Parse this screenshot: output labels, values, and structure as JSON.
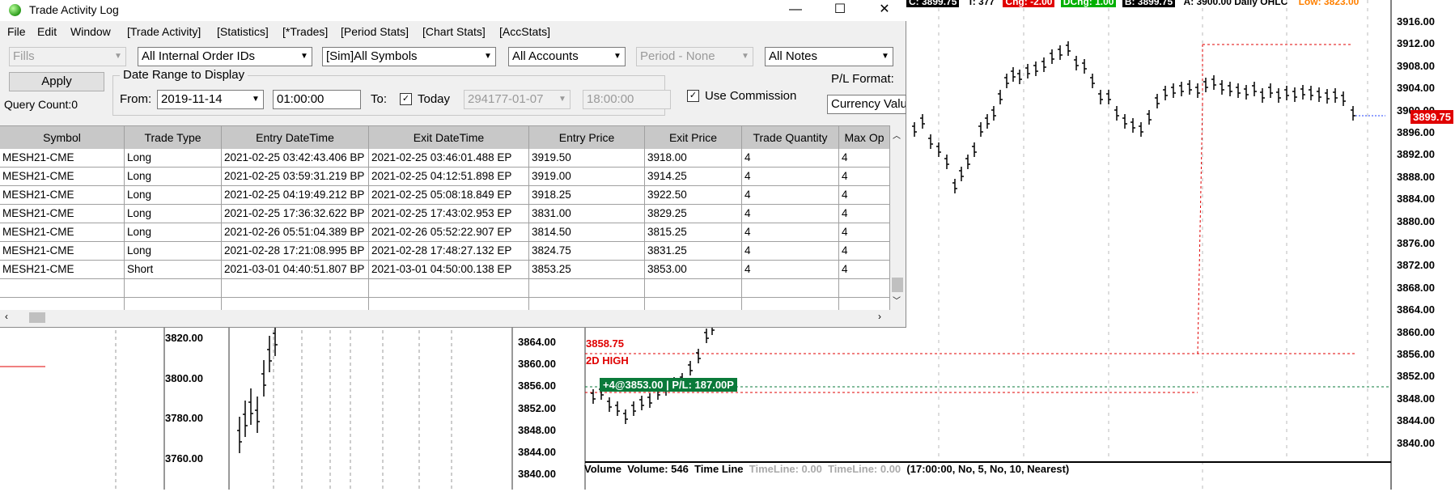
{
  "window": {
    "title": "Trade Activity Log",
    "minimize": "—",
    "maximize": "☐",
    "close": "✕"
  },
  "menu": [
    "File",
    "Edit",
    "Window",
    "[Trade Activity]",
    "[Statistics]",
    "[*Trades]",
    "[Period Stats]",
    "[Chart Stats]",
    "[AccStats]"
  ],
  "filters": {
    "fills": "Fills",
    "order_ids": "All Internal Order IDs",
    "symbols": "[Sim]All Symbols",
    "accounts": "All Accounts",
    "period": "Period - None",
    "notes": "All Notes"
  },
  "controls": {
    "apply_label": "Apply",
    "query_count": "Query Count:0",
    "date_range_label": "Date Range to Display",
    "from_label": "From:",
    "from_date": "2019-11-14",
    "from_time": "01:00:00",
    "to_label": "To:",
    "today_label": "Today",
    "today_checked": true,
    "to_date": "294177-01-07",
    "to_time": "18:00:00",
    "use_commission_label": "Use Commission",
    "use_commission_checked": true,
    "pl_format_label": "P/L Format:",
    "pl_format_value": "Currency Value"
  },
  "table": {
    "columns": [
      "Symbol",
      "Trade Type",
      "Entry DateTime",
      "Exit DateTime",
      "Entry Price",
      "Exit Price",
      "Trade Quantity",
      "Max Op"
    ],
    "rows": [
      [
        "MESH21-CME",
        "Long",
        "2021-02-25  03:42:43.406 BP",
        "2021-02-25  03:46:01.488 EP",
        "3919.50",
        "3918.00",
        "4",
        "4"
      ],
      [
        "MESH21-CME",
        "Long",
        "2021-02-25  03:59:31.219 BP",
        "2021-02-25  04:12:51.898 EP",
        "3919.00",
        "3914.25",
        "4",
        "4"
      ],
      [
        "MESH21-CME",
        "Long",
        "2021-02-25  04:19:49.212 BP",
        "2021-02-25  05:08:18.849 EP",
        "3918.25",
        "3922.50",
        "4",
        "4"
      ],
      [
        "MESH21-CME",
        "Long",
        "2021-02-25  17:36:32.622 BP",
        "2021-02-25  17:43:02.953 EP",
        "3831.00",
        "3829.25",
        "4",
        "4"
      ],
      [
        "MESH21-CME",
        "Long",
        "2021-02-26  05:51:04.389 BP",
        "2021-02-26  05:52:22.907 EP",
        "3814.50",
        "3815.25",
        "4",
        "4"
      ],
      [
        "MESH21-CME",
        "Long",
        "2021-02-28  17:21:08.995 BP",
        "2021-02-28  17:48:27.132 EP",
        "3824.75",
        "3831.25",
        "4",
        "4"
      ],
      [
        "MESH21-CME",
        "Short",
        "2021-03-01  04:40:51.807 BP",
        "2021-03-01  04:50:00.138 EP",
        "3853.25",
        "3853.00",
        "4",
        "4"
      ],
      [
        "",
        "",
        "",
        "",
        "",
        "",
        "",
        ""
      ],
      [
        "",
        "",
        "",
        "",
        "",
        "",
        "",
        ""
      ]
    ]
  },
  "chart": {
    "header": [
      {
        "text": "C: 3899.75",
        "bg": "#000000",
        "fg": "#ffffff"
      },
      {
        "text": "T: 377",
        "bg": "#ffffff",
        "fg": "#000000"
      },
      {
        "text": "Chg: -2.00",
        "bg": "#e00000",
        "fg": "#ffffff"
      },
      {
        "text": "DChg: 1.00",
        "bg": "#00b000",
        "fg": "#ffffff"
      },
      {
        "text": "B: 3899.75",
        "bg": "#000000",
        "fg": "#ffffff"
      },
      {
        "text": "A: 3900.00 Daily OHLC",
        "bg": "#ffffff",
        "fg": "#000000"
      },
      {
        "text": "Low: 3823.00",
        "bg": "#ffffff",
        "fg": "#ff8000"
      }
    ],
    "right_axis": [
      "3916.00",
      "3912.00",
      "3908.00",
      "3904.00",
      "3900.00",
      "3896.00",
      "3892.00",
      "3888.00",
      "3884.00",
      "3880.00",
      "3876.00",
      "3872.00",
      "3868.00",
      "3864.00",
      "3860.00",
      "3856.00",
      "3852.00",
      "3848.00",
      "3844.00",
      "3840.00"
    ],
    "mid_axis": [
      "3864.00",
      "3860.00",
      "3856.00",
      "3852.00",
      "3848.00",
      "3844.00",
      "3840.00"
    ],
    "left_axis": [
      "3820.00",
      "3800.00",
      "3780.00",
      "3760.00"
    ],
    "last_price": "3899.75",
    "high_value": "3858.75",
    "high_label": "2D HIGH",
    "position_label": "+4@3853.00 | P/L: 187.00P",
    "volume_bar": {
      "label1": "Volume",
      "label2": "Volume: 546",
      "label3": "Time Line",
      "dim1": "TimeLine: 0.00",
      "dim2": "TimeLine: 0.00",
      "params": "(17:00:00, No, 5, No, 10, Nearest)"
    },
    "colors": {
      "accent_red": "#e00000",
      "position_green": "#0a7a3a"
    }
  }
}
